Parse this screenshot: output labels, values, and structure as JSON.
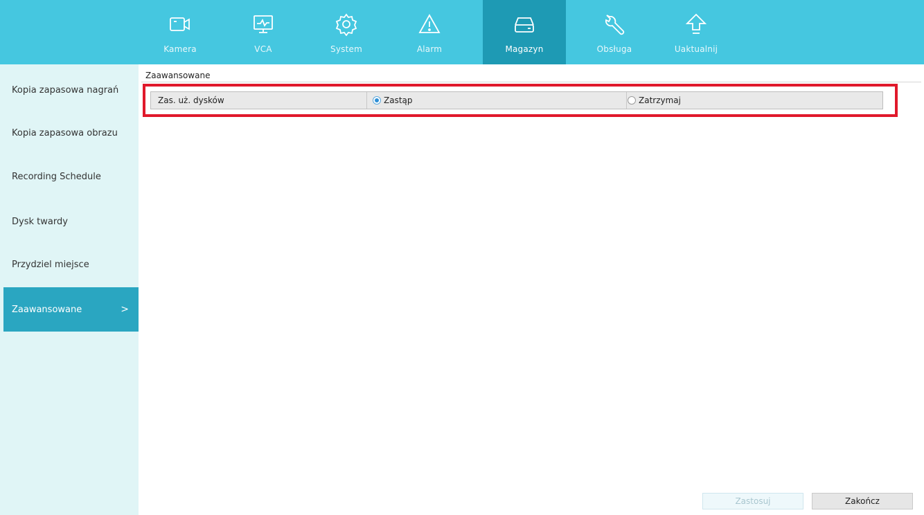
{
  "nav": {
    "items": [
      {
        "label": "Kamera",
        "icon": "camera-icon"
      },
      {
        "label": "VCA",
        "icon": "monitor-chart-icon"
      },
      {
        "label": "System",
        "icon": "gear-icon"
      },
      {
        "label": "Alarm",
        "icon": "warning-icon"
      },
      {
        "label": "Magazyn",
        "icon": "storage-drive-icon"
      },
      {
        "label": "Obsługa",
        "icon": "wrench-icon"
      },
      {
        "label": "Uaktualnij",
        "icon": "upload-arrow-icon"
      }
    ],
    "active": "Magazyn"
  },
  "sidebar": {
    "items": [
      {
        "label": "Kopia zapasowa nagrań"
      },
      {
        "label": "Kopia zapasowa obrazu"
      },
      {
        "label": "Recording Schedule"
      },
      {
        "label": "Dysk twardy"
      },
      {
        "label": "Przydziel miejsce"
      },
      {
        "label": "Zaawansowane"
      }
    ],
    "active": "Zaawansowane",
    "active_chevron": ">"
  },
  "content": {
    "tab_title": "Zaawansowane",
    "setting": {
      "label": "Zas. uż. dysków",
      "options": [
        {
          "label": "Zastąp",
          "selected": true
        },
        {
          "label": "Zatrzymaj",
          "selected": false
        }
      ]
    }
  },
  "buttons": {
    "apply": "Zastosuj",
    "close": "Zakończ"
  },
  "colors": {
    "topbar": "#45c7e0",
    "active_nav": "#1e9ab4",
    "sidebar_bg": "#e0f5f6",
    "sidebar_active": "#2aa6c1",
    "highlight": "#e0192b"
  }
}
